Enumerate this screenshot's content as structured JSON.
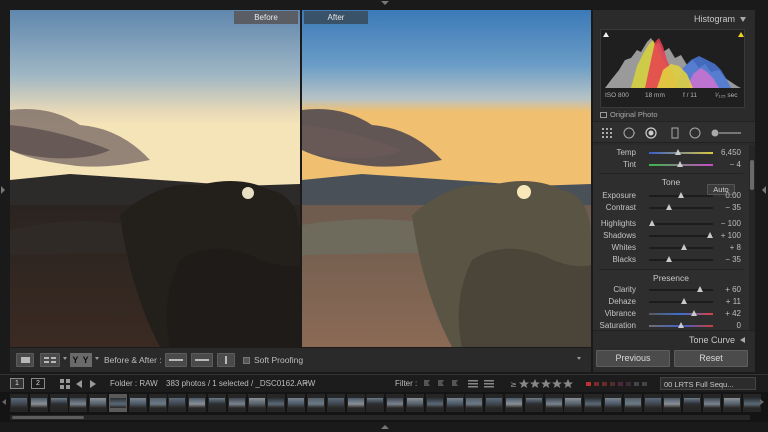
{
  "photo_labels": {
    "before": "Before",
    "after": "After"
  },
  "toolbar": {
    "yy_label": "Y Y",
    "before_after_label": "Before & After :",
    "soft_proofing_label": "Soft Proofing"
  },
  "histogram": {
    "title": "Histogram",
    "iso": "ISO 800",
    "focal": "18 mm",
    "aperture": "f / 11",
    "shutter": "¹⁄₁₂₅ sec",
    "original_photo": "Original Photo"
  },
  "basic": {
    "temp": {
      "label": "Temp",
      "value": "6,450",
      "pos": 0.46
    },
    "tint": {
      "label": "Tint",
      "value": "− 4",
      "pos": 0.48
    },
    "tone_title": "Tone",
    "auto_label": "Auto",
    "exposure": {
      "label": "Exposure",
      "value": "0.00",
      "pos": 0.5
    },
    "contrast": {
      "label": "Contrast",
      "value": "− 35",
      "pos": 0.32
    },
    "highlights": {
      "label": "Highlights",
      "value": "− 100",
      "pos": 0.05
    },
    "shadows": {
      "label": "Shadows",
      "value": "+ 100",
      "pos": 0.96
    },
    "whites": {
      "label": "Whites",
      "value": "+ 8",
      "pos": 0.54
    },
    "blacks": {
      "label": "Blacks",
      "value": "− 35",
      "pos": 0.32
    },
    "presence_title": "Presence",
    "clarity": {
      "label": "Clarity",
      "value": "+ 60",
      "pos": 0.8
    },
    "dehaze": {
      "label": "Dehaze",
      "value": "+ 11",
      "pos": 0.55
    },
    "vibrance": {
      "label": "Vibrance",
      "value": "+ 42",
      "pos": 0.7
    },
    "saturation": {
      "label": "Saturation",
      "value": "0",
      "pos": 0.5
    }
  },
  "tone_curve": {
    "title": "Tone Curve"
  },
  "buttons": {
    "previous": "Previous",
    "reset": "Reset"
  },
  "filmstrip_bar": {
    "monitor1": "1",
    "monitor2": "2",
    "folder": "Folder : RAW",
    "count": "383 photos / 1 selected / _DSC0162.ARW",
    "filter_label": "Filter :",
    "preset": "00 LRTS Full Sequ..."
  },
  "colors": {
    "accent_before": "#5a5e64",
    "accent_after": "#3a5268"
  }
}
